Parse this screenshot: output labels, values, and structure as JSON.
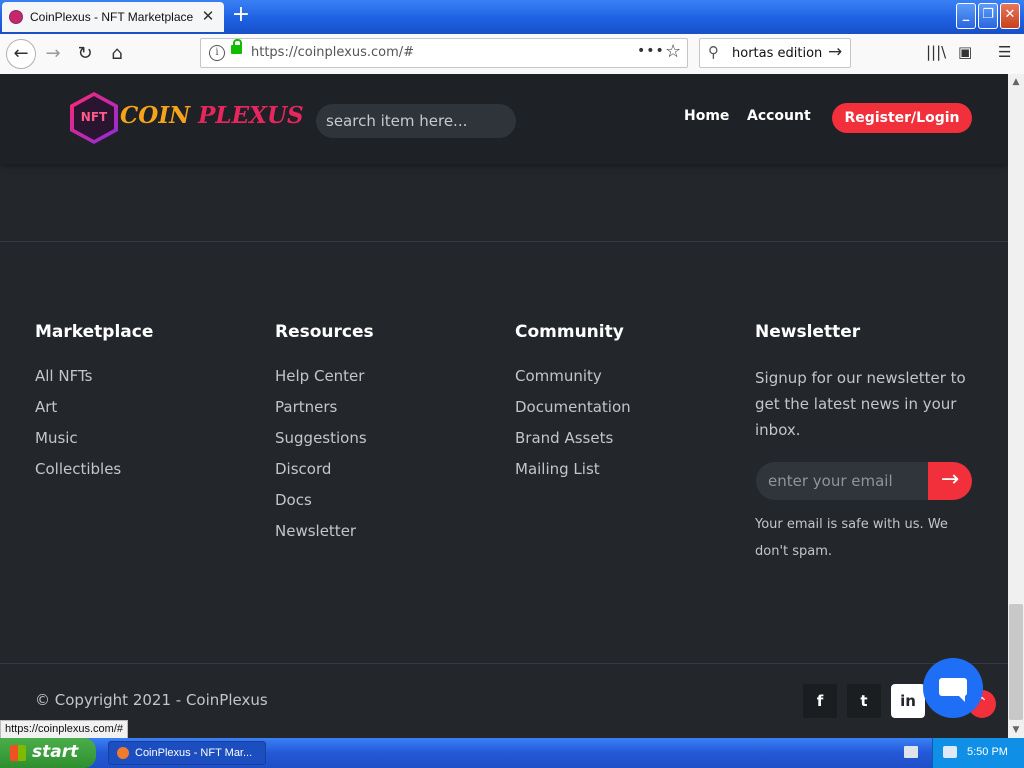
{
  "browser": {
    "tab_title": "CoinPlexus - NFT Marketplace",
    "tab_close": "✕",
    "new_tab": "+",
    "url": "https://coinplexus.com/#",
    "url_dots": "•••",
    "search_query": "hortas edition",
    "status_url": "https://coinplexus.com/#"
  },
  "header": {
    "logo_badge": "NFT",
    "logo_part1": "COIN ",
    "logo_part2": "PLEXUS",
    "search_placeholder": "search item here...",
    "nav": [
      "Home",
      "Account"
    ],
    "register_label": "Register/Login"
  },
  "footer": {
    "columns": [
      {
        "title": "Marketplace",
        "links": [
          "All NFTs",
          "Art",
          "Music",
          "Collectibles"
        ]
      },
      {
        "title": "Resources",
        "links": [
          "Help Center",
          "Partners",
          "Suggestions",
          "Discord",
          "Docs",
          "Newsletter"
        ]
      },
      {
        "title": "Community",
        "links": [
          "Community",
          "Documentation",
          "Brand Assets",
          "Mailing List"
        ]
      }
    ],
    "newsletter": {
      "title": "Newsletter",
      "text": "Signup for our newsletter to get the latest news in your inbox.",
      "email_placeholder": "enter your email",
      "safe_text": "Your email is safe with us. We don't spam."
    },
    "copyright": "© Copyright 2021 - CoinPlexus",
    "social": [
      "f",
      "t",
      "in"
    ]
  },
  "taskbar": {
    "start_label": "start",
    "task_label": "CoinPlexus - NFT Mar...",
    "clock": "5:50 PM"
  },
  "colors": {
    "accent": "#f2303c",
    "page_bg": "#23272b",
    "header_bg": "#1e2125"
  }
}
